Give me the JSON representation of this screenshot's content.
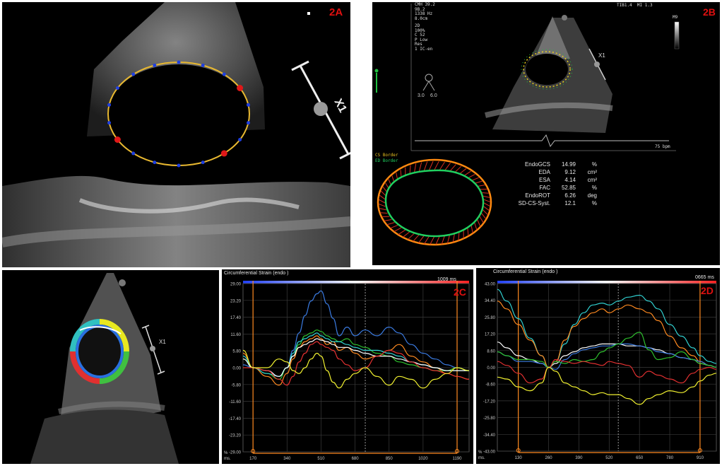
{
  "panels": {
    "a": {
      "label": "2A",
      "marker": "X1"
    },
    "b": {
      "label": "2B",
      "marker": "X1",
      "header_lines": [
        "CMH 39.2",
        "9B.2",
        "1338 Hz",
        "8.0cm",
        "2D",
        "100%",
        "C 52",
        "P Low",
        "Res",
        "1 IC-en"
      ],
      "header_right": "TIB1.4  MI 1.3",
      "gray_scale": "M9",
      "heart_rate": "75 bpm",
      "scale_vals": [
        "3.0",
        "6.0"
      ],
      "legend": [
        {
          "text": "CS Border",
          "color": "#e8c020"
        },
        {
          "text": "ED Border",
          "color": "#20d060"
        }
      ],
      "measurements": [
        {
          "name": "EndoGCS",
          "value": "14.99",
          "unit": "%"
        },
        {
          "name": "EDA",
          "value": "9.12",
          "unit": "cm²"
        },
        {
          "name": "ESA",
          "value": "4.14",
          "unit": "cm²"
        },
        {
          "name": "FAC",
          "value": "52.85",
          "unit": "%"
        },
        {
          "name": "EndoROT",
          "value": "6.26",
          "unit": "deg"
        },
        {
          "name": "SD-CS-Syst.",
          "value": "12.1",
          "unit": "%"
        }
      ]
    },
    "e": {
      "marker": "X1"
    }
  },
  "chart_data": [
    {
      "type": "line",
      "panel_label": "2C",
      "title": "Circumferential Strain (endo )",
      "duration": "1009 ms",
      "x_unit": "ms.",
      "ylabel": "%",
      "ylim": [
        -29.0,
        29.0
      ],
      "y_ticks": [
        "29.00",
        "23.20",
        "17.40",
        "11.60",
        "5.80",
        "0.00",
        "-5.80",
        "-11.60",
        "-17.40",
        "-23.20",
        "-29.00"
      ],
      "xlim": [
        120,
        1250
      ],
      "x_ticks": [
        "170",
        "340",
        "510",
        "680",
        "850",
        "1020",
        "1190"
      ],
      "x": [
        120,
        170,
        240,
        300,
        340,
        370,
        400,
        430,
        460,
        490,
        510,
        540,
        570,
        600,
        640,
        680,
        730,
        790,
        850,
        900,
        960,
        1020,
        1080,
        1140,
        1190,
        1250
      ],
      "series": [
        {
          "color": "#3a7ae0",
          "values": [
            1,
            0,
            -1,
            -3,
            0,
            6,
            12,
            18,
            23,
            25.5,
            26.5,
            22,
            17,
            11,
            14,
            11,
            13,
            11,
            14,
            12,
            8,
            5,
            3,
            1,
            0,
            -1
          ]
        },
        {
          "color": "#2ec02e",
          "values": [
            3,
            0,
            -2,
            -4,
            0,
            4,
            8,
            11,
            12,
            13,
            12.5,
            11,
            10,
            9,
            10,
            8,
            7,
            5,
            4,
            2,
            1,
            0,
            -1,
            -1,
            0,
            -1
          ]
        },
        {
          "color": "#ff8a20",
          "values": [
            5,
            0,
            -3,
            -6,
            -2,
            3,
            7,
            9,
            10,
            11,
            10,
            8,
            9,
            6,
            7,
            5,
            3,
            4,
            6,
            8,
            4,
            2,
            0,
            -2,
            -3,
            -4
          ]
        },
        {
          "color": "#30d0d0",
          "values": [
            4,
            0,
            -2,
            -3,
            0,
            5,
            9,
            10,
            11,
            12,
            11,
            10,
            9,
            9,
            8,
            7,
            6,
            6,
            5,
            4,
            2,
            1,
            0,
            -1,
            -1,
            -1
          ]
        },
        {
          "color": "#ffffff",
          "values": [
            3,
            0,
            -1,
            -3,
            0,
            4,
            7,
            8,
            9,
            10,
            9.5,
            9,
            8,
            7,
            7,
            6,
            5,
            4,
            4,
            3,
            2,
            1,
            0,
            -1,
            -1,
            -1
          ]
        },
        {
          "color": "#e03030",
          "values": [
            0,
            0,
            -1,
            -4,
            -6,
            -3,
            2,
            5,
            8,
            9,
            8,
            7,
            6,
            3,
            1,
            -1,
            0,
            4,
            6,
            5,
            2,
            0,
            -1,
            -2,
            -3,
            -4
          ]
        },
        {
          "color": "#f0f030",
          "values": [
            6,
            0,
            0,
            3,
            2,
            -1,
            -2,
            0,
            3,
            5,
            4,
            -1,
            -5,
            -7,
            -4,
            -2,
            0,
            -3,
            -6,
            -3,
            -4,
            -7,
            -4,
            -2,
            0,
            -1
          ]
        }
      ]
    },
    {
      "type": "line",
      "panel_label": "2D",
      "title": "Circumferential Strain (endo )",
      "duration": "0665 ms",
      "x_unit": "ms.",
      "ylabel": "%",
      "ylim": [
        -43.0,
        43.0
      ],
      "y_ticks": [
        "43.00",
        "34.40",
        "25.80",
        "17.20",
        "8.60",
        "0.00",
        "-8.60",
        "-17.20",
        "-25.80",
        "-34.40",
        "-43.00"
      ],
      "xlim": [
        40,
        980
      ],
      "x_ticks": [
        "130",
        "260",
        "390",
        "520",
        "650",
        "780",
        "910"
      ],
      "x": [
        40,
        80,
        130,
        180,
        230,
        260,
        290,
        330,
        370,
        410,
        450,
        490,
        520,
        560,
        600,
        650,
        690,
        730,
        780,
        830,
        880,
        910,
        950,
        980
      ],
      "series": [
        {
          "color": "#30d0d0",
          "values": [
            40,
            34,
            25,
            15,
            6,
            0,
            3,
            12,
            22,
            28,
            32,
            33,
            32,
            34,
            36,
            37,
            34,
            30,
            22,
            16,
            10,
            6,
            3,
            2
          ]
        },
        {
          "color": "#ff8a20",
          "values": [
            34,
            30,
            22,
            14,
            6,
            0,
            3,
            14,
            21,
            25,
            28,
            30,
            28,
            30,
            32,
            30,
            28,
            24,
            16,
            10,
            6,
            3,
            1,
            0
          ]
        },
        {
          "color": "#ffffff",
          "values": [
            13,
            10,
            6,
            4,
            2,
            0,
            2,
            6,
            8,
            10,
            11,
            12,
            12,
            12,
            11,
            11,
            10,
            9,
            7,
            5,
            4,
            2,
            1,
            0
          ]
        },
        {
          "color": "#3a7ae0",
          "values": [
            8,
            6,
            3,
            3,
            2,
            0,
            -1,
            4,
            7,
            9,
            10,
            11,
            11,
            12,
            12,
            11,
            10,
            8,
            7,
            5,
            4,
            3,
            1,
            0
          ]
        },
        {
          "color": "#2ec02e",
          "values": [
            8,
            6,
            4,
            4,
            3,
            0,
            3,
            2,
            4,
            3,
            4,
            8,
            10,
            12,
            15,
            18,
            9,
            4,
            5,
            8,
            4,
            2,
            1,
            0
          ]
        },
        {
          "color": "#e03030",
          "values": [
            3,
            1,
            -3,
            -8,
            -6,
            0,
            4,
            3,
            2,
            3,
            2,
            1,
            3,
            2,
            1,
            -5,
            -2,
            -4,
            -6,
            -8,
            -3,
            -1,
            0,
            -1
          ]
        },
        {
          "color": "#f0f030",
          "values": [
            -5,
            -6,
            -10,
            -12,
            -8,
            0,
            -2,
            -8,
            -10,
            -12,
            -14,
            -13,
            -14,
            -14,
            -16,
            -19,
            -16,
            -14,
            -12,
            -13,
            -10,
            -7,
            -4,
            -3
          ]
        }
      ]
    }
  ]
}
